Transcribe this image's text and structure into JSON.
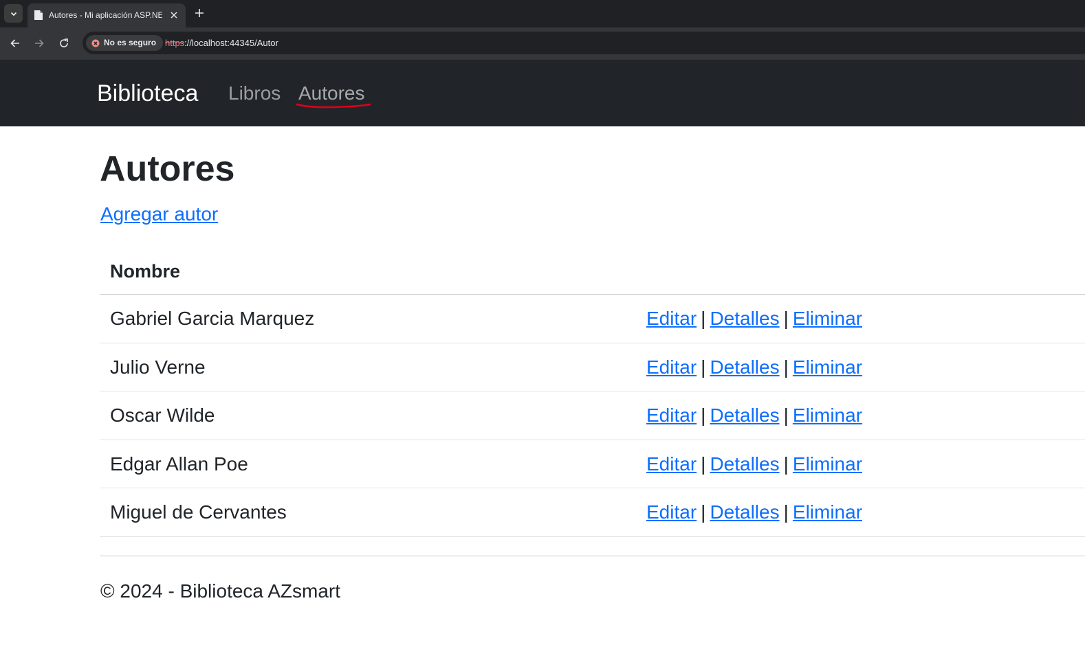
{
  "browser": {
    "tab_title": "Autores - Mi aplicación ASP.NET",
    "security_label": "No es seguro",
    "url_scheme": "https",
    "url_rest": "://localhost:44345/Autor"
  },
  "navbar": {
    "brand": "Biblioteca",
    "links": [
      "Libros",
      "Autores"
    ]
  },
  "page": {
    "title": "Autores",
    "add_link": "Agregar autor"
  },
  "table": {
    "header": "Nombre",
    "rows": [
      {
        "name": "Gabriel Garcia Marquez"
      },
      {
        "name": "Julio Verne"
      },
      {
        "name": "Oscar Wilde"
      },
      {
        "name": "Edgar Allan Poe"
      },
      {
        "name": "Miguel de Cervantes"
      }
    ],
    "actions": {
      "edit": "Editar",
      "details": "Detalles",
      "delete": "Eliminar",
      "separator": "|"
    }
  },
  "footer": {
    "text": "© 2024 - Biblioteca AZsmart"
  },
  "colors": {
    "navbar_bg": "#212529",
    "link": "#0d6efd",
    "annotation": "#e0001b"
  }
}
